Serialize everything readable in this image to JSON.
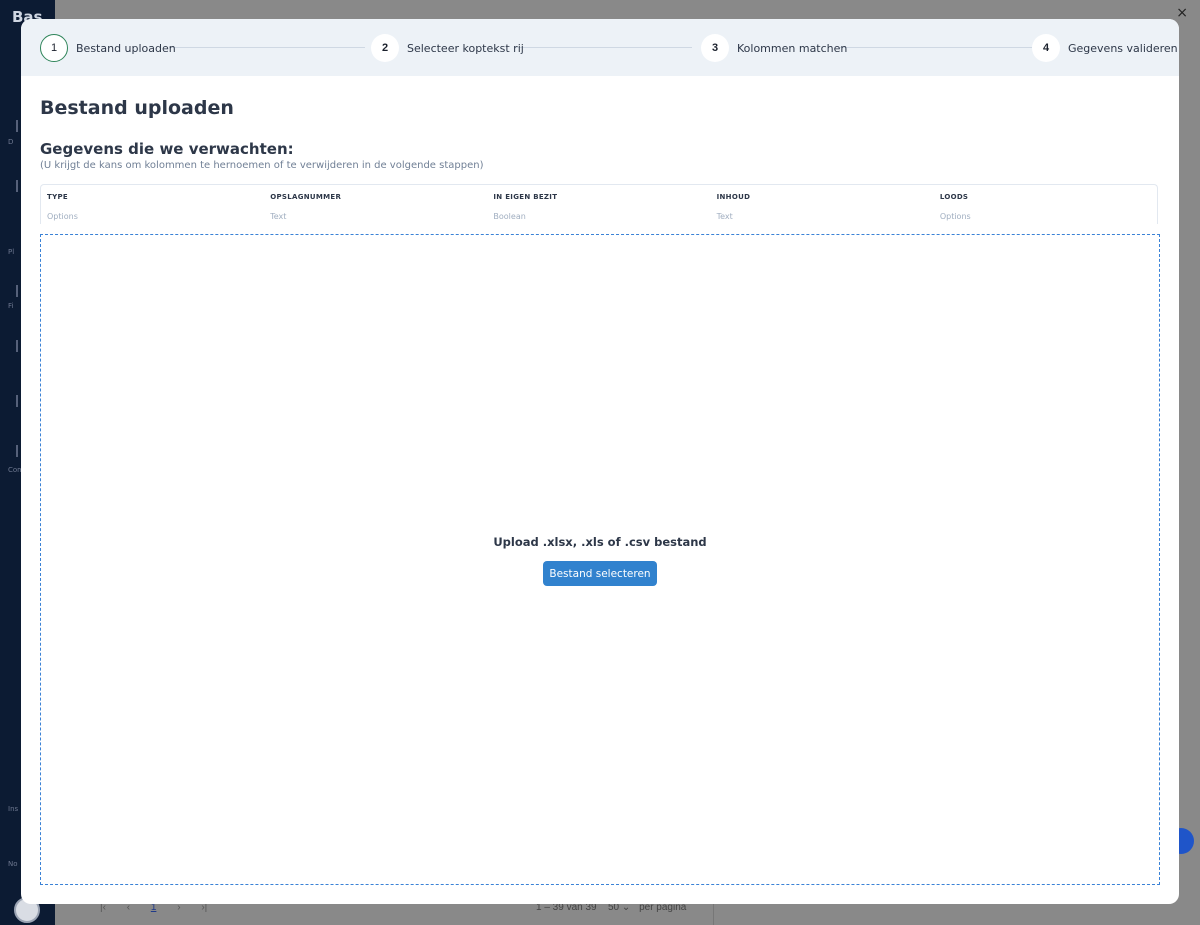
{
  "background": {
    "brand": "Bas",
    "close_glyph": "×",
    "sidebar_labels": [
      "D",
      "Pl",
      "Fi",
      "Com",
      "Ins",
      "No"
    ],
    "pagination": {
      "first": "|‹",
      "prev": "‹",
      "current": "1",
      "next": "›",
      "last": "›|"
    },
    "range": "1 – 39 van 39",
    "per_page_value": "50",
    "per_page_label": "per pagina"
  },
  "stepper": {
    "steps": [
      {
        "number": "1",
        "label": "Bestand uploaden",
        "active": true
      },
      {
        "number": "2",
        "label": "Selecteer koptekst rij",
        "active": false
      },
      {
        "number": "3",
        "label": "Kolommen matchen",
        "active": false
      },
      {
        "number": "4",
        "label": "Gegevens valideren",
        "active": false
      }
    ]
  },
  "main": {
    "title": "Bestand uploaden",
    "subtitle": "Gegevens die we verwachten:",
    "hint": "(U krijgt de kans om kolommen te hernoemen of te verwijderen in de volgende stappen)",
    "columns": [
      {
        "header": "TYPE",
        "type": "Options"
      },
      {
        "header": "OPSLAGNUMMER",
        "type": "Text"
      },
      {
        "header": "IN EIGEN BEZIT",
        "type": "Boolean"
      },
      {
        "header": "INHOUD",
        "type": "Text"
      },
      {
        "header": "LOODS",
        "type": "Options"
      }
    ]
  },
  "dropzone": {
    "text": "Upload .xlsx, .xls of .csv bestand",
    "button": "Bestand selecteren"
  },
  "colors": {
    "accent": "#3182ce",
    "active_step": "#2f855a",
    "stepper_bg": "#edf2f7",
    "sidebar": "#0c1b33"
  }
}
